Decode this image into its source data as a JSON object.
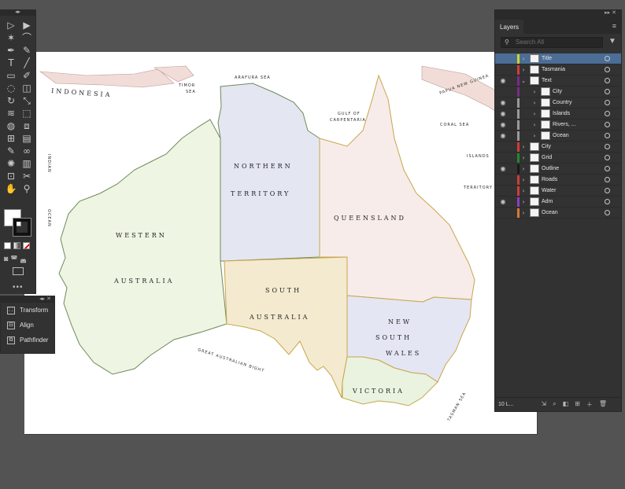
{
  "map": {
    "states": {
      "western_australia": [
        "WESTERN",
        "AUSTRALIA"
      ],
      "northern_territory": [
        "NORTHERN",
        "TERRITORY"
      ],
      "queensland": "QUEENSLAND",
      "south_australia": [
        "SOUTH",
        "AUSTRALIA"
      ],
      "new_south_wales": [
        "NEW",
        "SOUTH",
        "WALES"
      ],
      "victoria": "VICTORIA"
    },
    "sea_labels": {
      "indonesia": "INDONESIA",
      "arafura": "ARAFURA SEA",
      "timor": "TIMOR",
      "timor_sea": "SEA",
      "gulf": "GULF OF",
      "carpentaria": "CARPENTARIA",
      "coral_sea": "CORAL SEA",
      "islands": "ISLANDS",
      "territory": "TERRITORY",
      "new_guinea": "PAPUA NEW GUINEA",
      "indian": "INDIAN",
      "ocean": "OCEAN",
      "bight": "GREAT AUSTRALIAN BIGHT",
      "tasman": "TASMAN SEA"
    },
    "colors": {
      "wa": "#eef5e2",
      "nt": "#e4e6f2",
      "qld": "#f7ecea",
      "sa": "#f4ead0",
      "nsw": "#e5e6f3",
      "vic": "#e9f3df",
      "land_border": "#6f8a5a",
      "foreign": "#f2dcd8"
    }
  },
  "toolbar_icons": [
    "selection-icon",
    "direct-selection-icon",
    "magic-wand-icon",
    "lasso-icon",
    "pen-icon",
    "curvature-icon",
    "type-icon",
    "line-icon",
    "rectangle-icon",
    "paintbrush-icon",
    "shaper-icon",
    "eraser-icon",
    "rotate-icon",
    "scale-icon",
    "width-icon",
    "free-transform-icon",
    "shape-builder-icon",
    "perspective-icon",
    "mesh-icon",
    "gradient-icon",
    "eyedropper-icon",
    "blend-icon",
    "symbol-sprayer-icon",
    "column-graph-icon",
    "artboard-icon",
    "slice-icon",
    "hand-icon",
    "zoom-icon"
  ],
  "properties_panel": {
    "items": [
      {
        "label": "Transform",
        "icon": "transform-icon"
      },
      {
        "label": "Align",
        "icon": "align-icon"
      },
      {
        "label": "Pathfinder",
        "icon": "pathfinder-icon"
      }
    ]
  },
  "layers_panel": {
    "tab_label": "Layers",
    "search_placeholder": "Search All",
    "layers": [
      {
        "name": "Title",
        "color": "#c9d72a",
        "visible": false,
        "selected": true,
        "depth": 0,
        "arrow": "›"
      },
      {
        "name": "Tasmania",
        "color": "#d23a3a",
        "visible": false,
        "selected": false,
        "depth": 0,
        "arrow": "›"
      },
      {
        "name": "Text",
        "color": "#7a2a8a",
        "visible": true,
        "selected": false,
        "depth": 0,
        "arrow": "⌄"
      },
      {
        "name": "City",
        "color": "#7a2a8a",
        "visible": false,
        "selected": false,
        "depth": 1,
        "arrow": "›"
      },
      {
        "name": "Country",
        "color": "#9a9a9a",
        "visible": true,
        "selected": false,
        "depth": 1,
        "arrow": "›"
      },
      {
        "name": "Islands",
        "color": "#9a9a9a",
        "visible": true,
        "selected": false,
        "depth": 1,
        "arrow": "›"
      },
      {
        "name": "Rivers, ...",
        "color": "#9a9a9a",
        "visible": true,
        "selected": false,
        "depth": 1,
        "arrow": "›"
      },
      {
        "name": "Ocean",
        "color": "#9a9a9a",
        "visible": true,
        "selected": false,
        "depth": 1,
        "arrow": "›"
      },
      {
        "name": "City",
        "color": "#d23a3a",
        "visible": false,
        "selected": false,
        "depth": 0,
        "arrow": "›"
      },
      {
        "name": "Grid",
        "color": "#1f8a2a",
        "visible": false,
        "selected": false,
        "depth": 0,
        "arrow": "›"
      },
      {
        "name": "Outline",
        "color": "#1a1a1a",
        "visible": true,
        "selected": false,
        "depth": 0,
        "arrow": "›"
      },
      {
        "name": "Roads",
        "color": "#d23a3a",
        "visible": false,
        "selected": false,
        "depth": 0,
        "arrow": "›"
      },
      {
        "name": "Water",
        "color": "#d23a3a",
        "visible": false,
        "selected": false,
        "depth": 0,
        "arrow": "›"
      },
      {
        "name": "Adm",
        "color": "#8a3fbf",
        "visible": true,
        "selected": false,
        "depth": 0,
        "arrow": "›"
      },
      {
        "name": "Ocean",
        "color": "#d27a3a",
        "visible": false,
        "selected": false,
        "depth": 0,
        "arrow": "›"
      }
    ],
    "footer_count": "10 L..."
  }
}
